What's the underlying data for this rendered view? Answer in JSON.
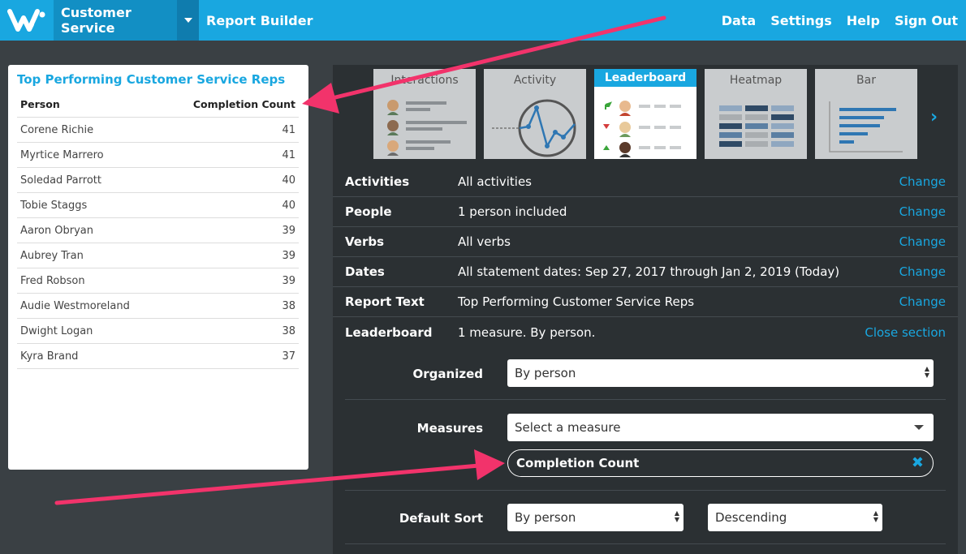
{
  "nav": {
    "breadcrumb": "Customer Service",
    "report_builder": "Report Builder",
    "links": [
      "Data",
      "Settings",
      "Help",
      "Sign Out"
    ]
  },
  "leaderboard": {
    "title": "Top Performing Customer Service Reps",
    "columns": [
      "Person",
      "Completion Count"
    ],
    "rows": [
      {
        "person": "Corene Richie",
        "count": "41"
      },
      {
        "person": "Myrtice Marrero",
        "count": "41"
      },
      {
        "person": "Soledad Parrott",
        "count": "40"
      },
      {
        "person": "Tobie Staggs",
        "count": "40"
      },
      {
        "person": "Aaron Obryan",
        "count": "39"
      },
      {
        "person": "Aubrey Tran",
        "count": "39"
      },
      {
        "person": "Fred Robson",
        "count": "39"
      },
      {
        "person": "Audie Westmoreland",
        "count": "38"
      },
      {
        "person": "Dwight Logan",
        "count": "38"
      },
      {
        "person": "Kyra Brand",
        "count": "37"
      }
    ]
  },
  "chart_types": [
    {
      "label": "Interactions",
      "selected": false
    },
    {
      "label": "Activity",
      "selected": false
    },
    {
      "label": "Leaderboard",
      "selected": true
    },
    {
      "label": "Heatmap",
      "selected": false
    },
    {
      "label": "Bar",
      "selected": false
    }
  ],
  "settings": [
    {
      "label": "Activities",
      "value": "All activities",
      "action": "Change"
    },
    {
      "label": "People",
      "value": "1 person included",
      "action": "Change"
    },
    {
      "label": "Verbs",
      "value": "All verbs",
      "action": "Change"
    },
    {
      "label": "Dates",
      "value": "All statement dates: Sep 27, 2017 through Jan 2, 2019 (Today)",
      "action": "Change"
    },
    {
      "label": "Report Text",
      "value": "Top Performing Customer Service Reps",
      "action": "Change"
    },
    {
      "label": "Leaderboard",
      "value": "1 measure. By person.",
      "action": "Close section"
    }
  ],
  "form": {
    "organized_label": "Organized",
    "organized_value": "By person",
    "measures_label": "Measures",
    "measures_placeholder": "Select a measure",
    "measure_chip": "Completion Count",
    "default_sort_label": "Default Sort",
    "sort_by_value": "By person",
    "sort_order_value": "Descending"
  },
  "colors": {
    "accent": "#19a7e0",
    "annotation_arrow": "#f2336b",
    "panel": "#2b3033",
    "background": "#3a4044"
  }
}
